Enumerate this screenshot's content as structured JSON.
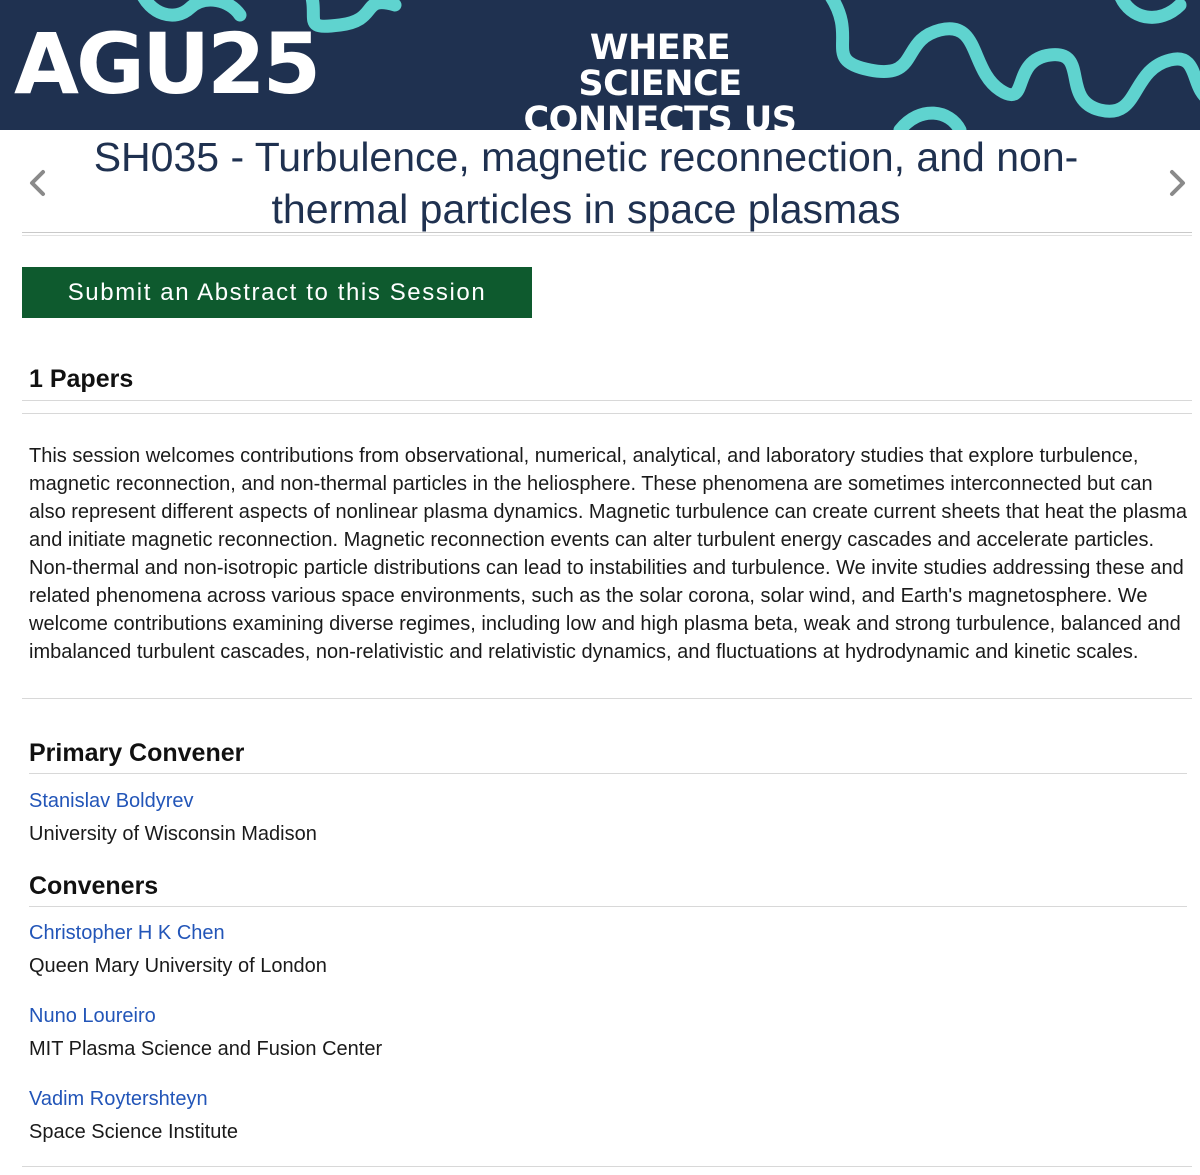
{
  "banner": {
    "logo": "AGU25",
    "tagline_line1": "WHERE SCIENCE",
    "tagline_line2": "CONNECTS US",
    "colors": {
      "background": "#1f3150",
      "accent": "#5fd3cf"
    }
  },
  "session": {
    "title": "SH035 - Turbulence, magnetic reconnection, and non-thermal particles in space plasmas",
    "submit_label": "Submit an Abstract to this Session",
    "papers_heading": "1 Papers",
    "description": "This session welcomes contributions from observational, numerical, analytical, and laboratory studies that explore turbulence, magnetic reconnection, and non-thermal particles in the heliosphere. These phenomena are sometimes interconnected but can also represent different aspects of nonlinear plasma dynamics. Magnetic turbulence can create current sheets that heat the plasma and initiate magnetic reconnection. Magnetic reconnection events can alter turbulent energy cascades and accelerate particles. Non-thermal and non-isotropic particle distributions can lead to instabilities and turbulence.  We invite studies addressing these and related phenomena across various space environments, such as the solar corona, solar wind, and Earth's magnetosphere. We welcome contributions examining diverse regimes, including low and high plasma beta, weak and strong turbulence, balanced and imbalanced turbulent cascades, non-relativistic and relativistic dynamics, and fluctuations at hydrodynamic and kinetic scales."
  },
  "primary_convener": {
    "heading": "Primary Convener",
    "name": "Stanislav Boldyrev",
    "affiliation": "University of Wisconsin Madison"
  },
  "conveners": {
    "heading": "Conveners",
    "people": [
      {
        "name": "Christopher H K Chen",
        "affiliation": "Queen Mary University of London"
      },
      {
        "name": "Nuno Loureiro",
        "affiliation": "MIT Plasma Science and Fusion Center"
      },
      {
        "name": "Vadim Roytershteyn",
        "affiliation": "Space Science Institute"
      }
    ]
  },
  "colors": {
    "title": "#1f3150",
    "button": "#0e5a2e",
    "link": "#2255b8"
  }
}
